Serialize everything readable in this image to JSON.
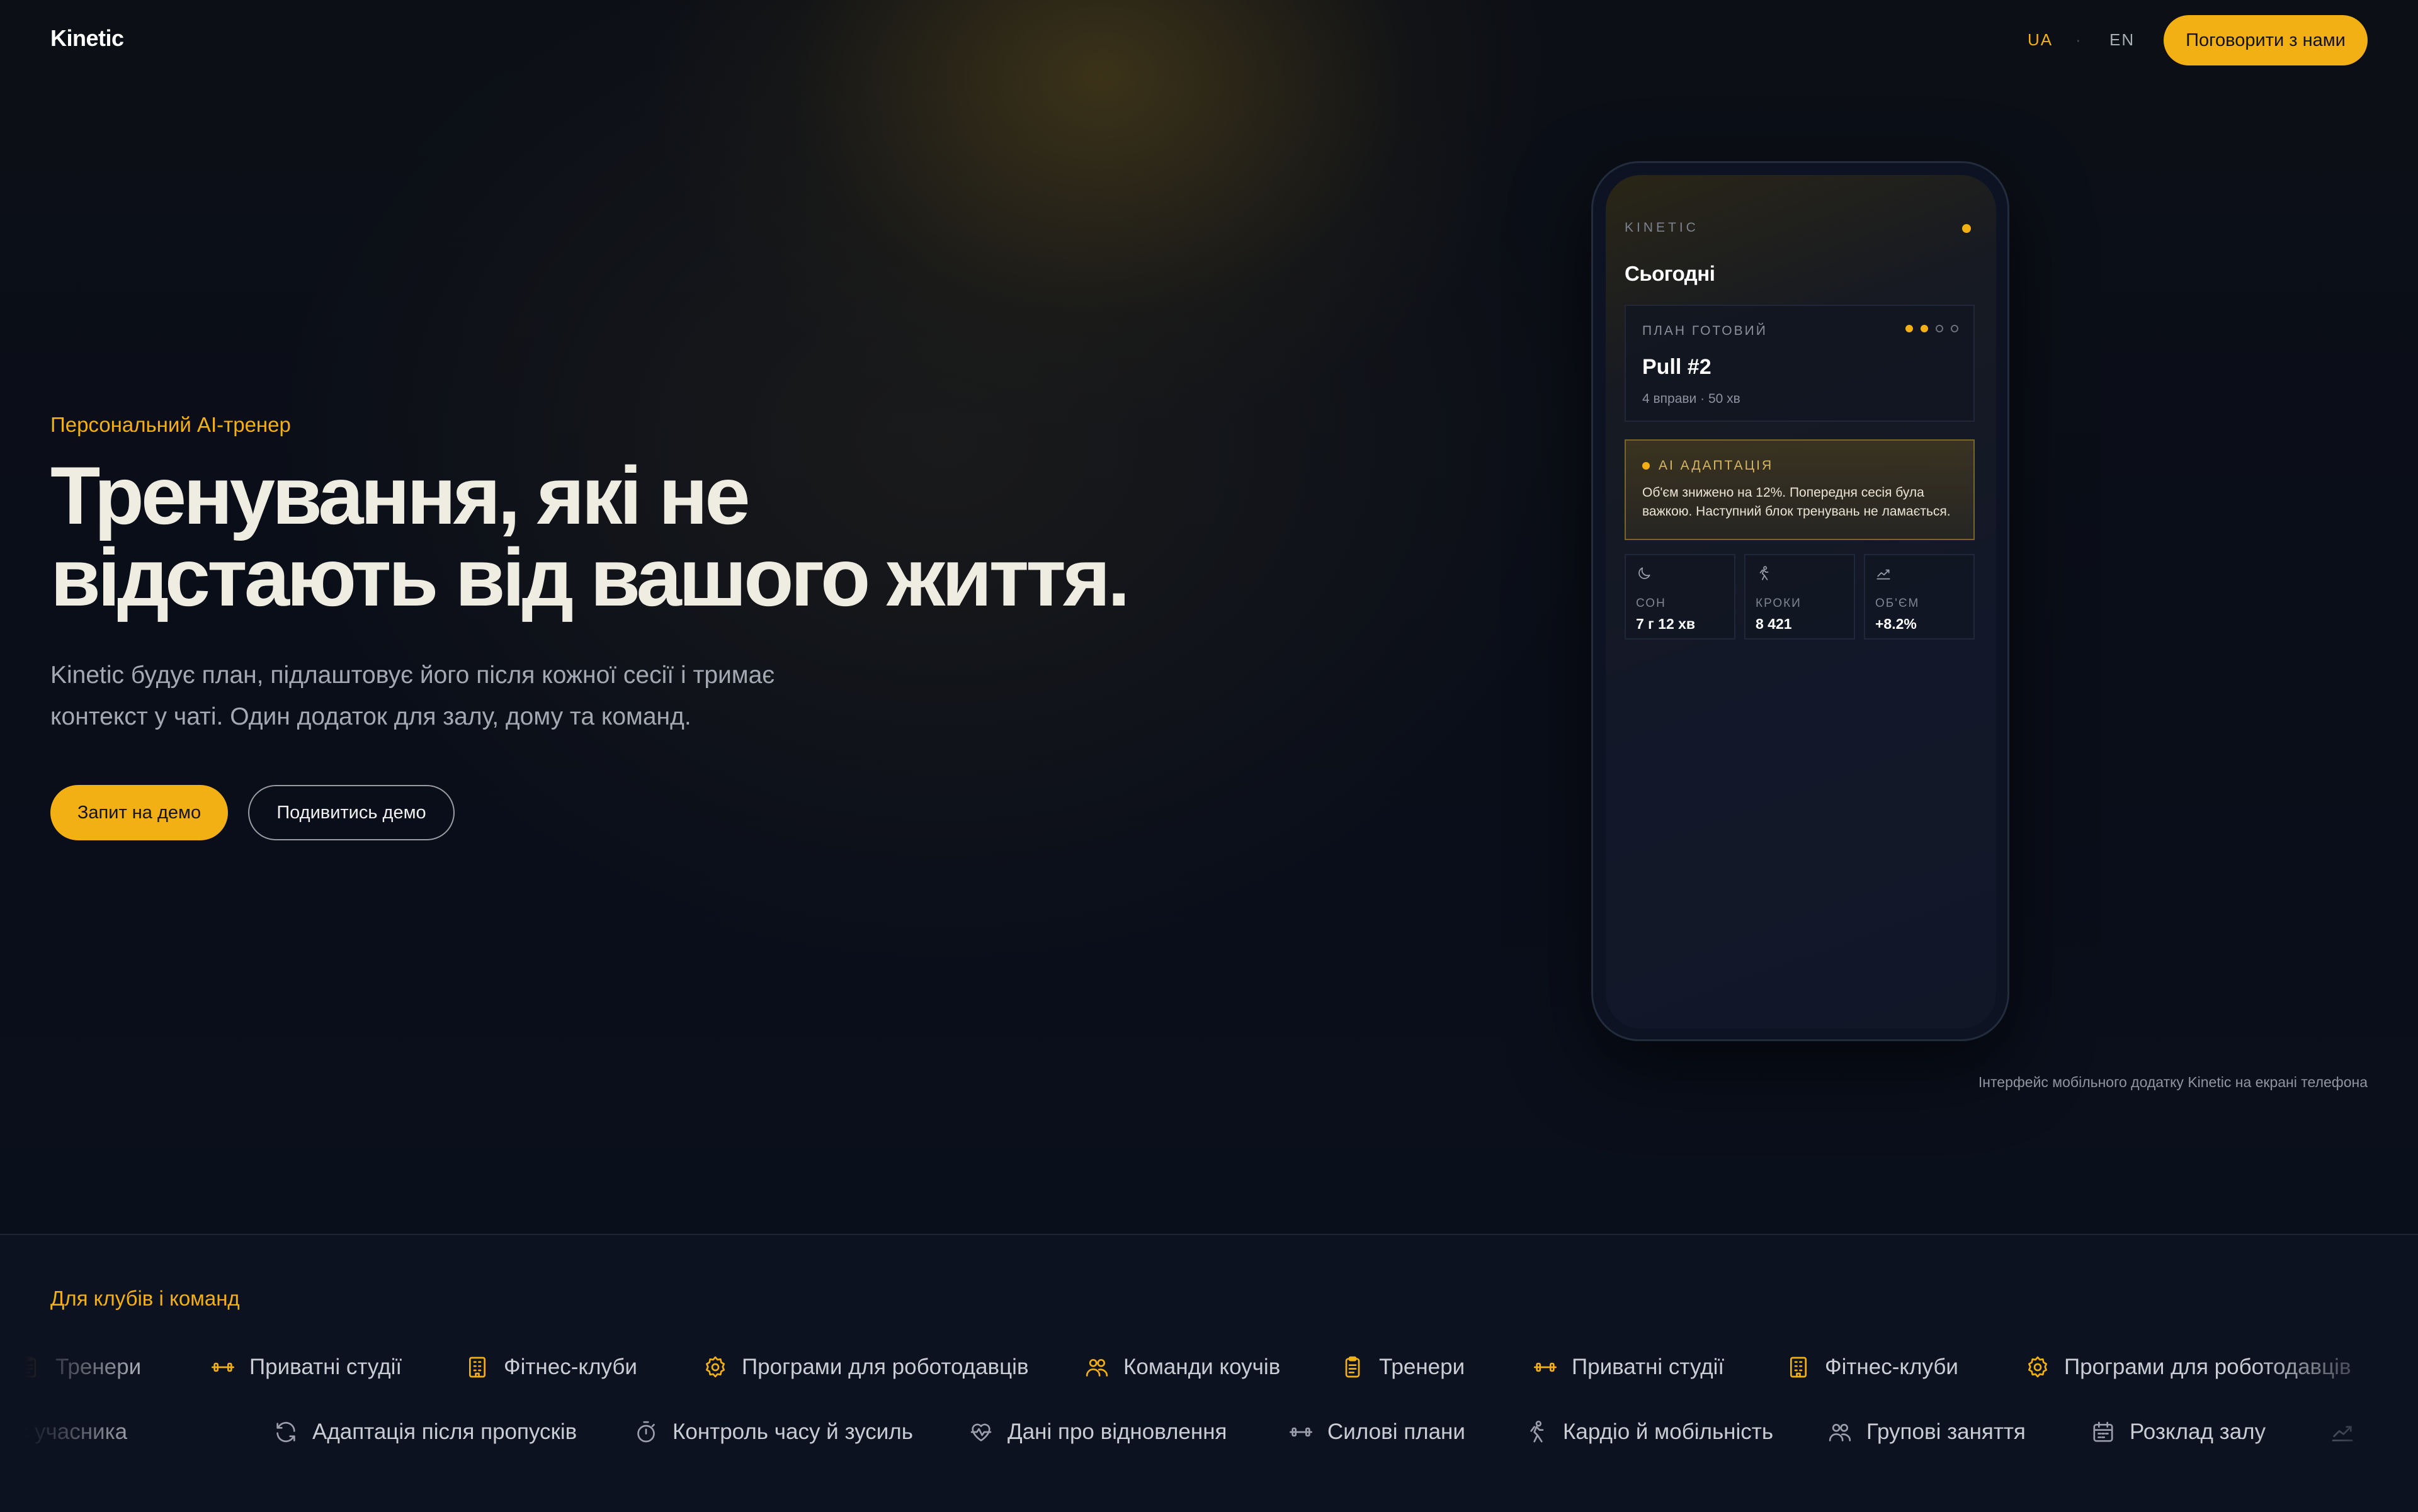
{
  "colors": {
    "accent": "#f3b015",
    "background": "#080c16",
    "text": "#efece2"
  },
  "header": {
    "logo": "Kinetic",
    "lang_ua": "UA",
    "lang_sep": "·",
    "lang_en": "EN",
    "cta": "Поговорити з нами"
  },
  "hero": {
    "eyebrow": "Персональний AI-тренер",
    "headline_line1": "Тренування, які не",
    "headline_line2": "відстають від вашого життя.",
    "sub_line1": "Kinetic будує план, підлаштовує його після кожної сесії і тримає",
    "sub_line2": "контекст у чаті. Один додаток для залу, дому та команд.",
    "primary_button": "Запит на демо",
    "secondary_button": "Подивитись демо"
  },
  "phone": {
    "brand": "KINETIC",
    "today": "Сьогодні",
    "plan": {
      "label": "ПЛАН ГОТОВИЙ",
      "title": "Pull #2",
      "meta": "4 вправи · 50 хв",
      "progress_steps_done": 2,
      "progress_steps_total": 4
    },
    "ai": {
      "label": "AI АДАПТАЦІЯ",
      "text": "Об'єм знижено на 12%. Попередня сесія була важкою. Наступний блок тренувань не ламається."
    },
    "stats": [
      {
        "icon": "moon-icon",
        "label": "СОН",
        "value": "7 г 12 хв"
      },
      {
        "icon": "running-icon",
        "label": "КРОКИ",
        "value": "8 421"
      },
      {
        "icon": "trend-up-icon",
        "label": "ОБ'ЄМ",
        "value": "+8.2%"
      }
    ]
  },
  "caption": "Інтерфейс мобільного додатку Kinetic на екрані телефона",
  "audience": {
    "label": "Для клубів і команд",
    "row1": [
      {
        "icon": "clipboard-icon",
        "label": "Тренери"
      },
      {
        "icon": "dumbbell-icon",
        "label": "Приватні студії"
      },
      {
        "icon": "building-icon",
        "label": "Фітнес-клуби"
      },
      {
        "icon": "gear-icon",
        "label": "Програми для роботодавців"
      },
      {
        "icon": "users-icon",
        "label": "Команди коучів"
      },
      {
        "icon": "clipboard-icon",
        "label": "Тренери"
      },
      {
        "icon": "dumbbell-icon",
        "label": "Приватні студії"
      },
      {
        "icon": "building-icon",
        "label": "Фітнес-клуби"
      },
      {
        "icon": "gear-icon",
        "label": "Програми для роботодавців"
      }
    ],
    "row2": [
      {
        "icon": "trend-up-icon",
        "label": "Прогрес учасника"
      },
      {
        "icon": "refresh-icon",
        "label": "Адаптація після пропусків"
      },
      {
        "icon": "stopwatch-icon",
        "label": "Контроль часу й зусиль"
      },
      {
        "icon": "heart-pulse-icon",
        "label": "Дані про відновлення"
      },
      {
        "icon": "dumbbell-icon",
        "label": "Силові плани"
      },
      {
        "icon": "running-icon",
        "label": "Кардіо й мобільність"
      },
      {
        "icon": "users-icon",
        "label": "Групові заняття"
      },
      {
        "icon": "calendar-icon",
        "label": "Розклад залу"
      },
      {
        "icon": "trend-up-icon",
        "label": ""
      }
    ]
  }
}
